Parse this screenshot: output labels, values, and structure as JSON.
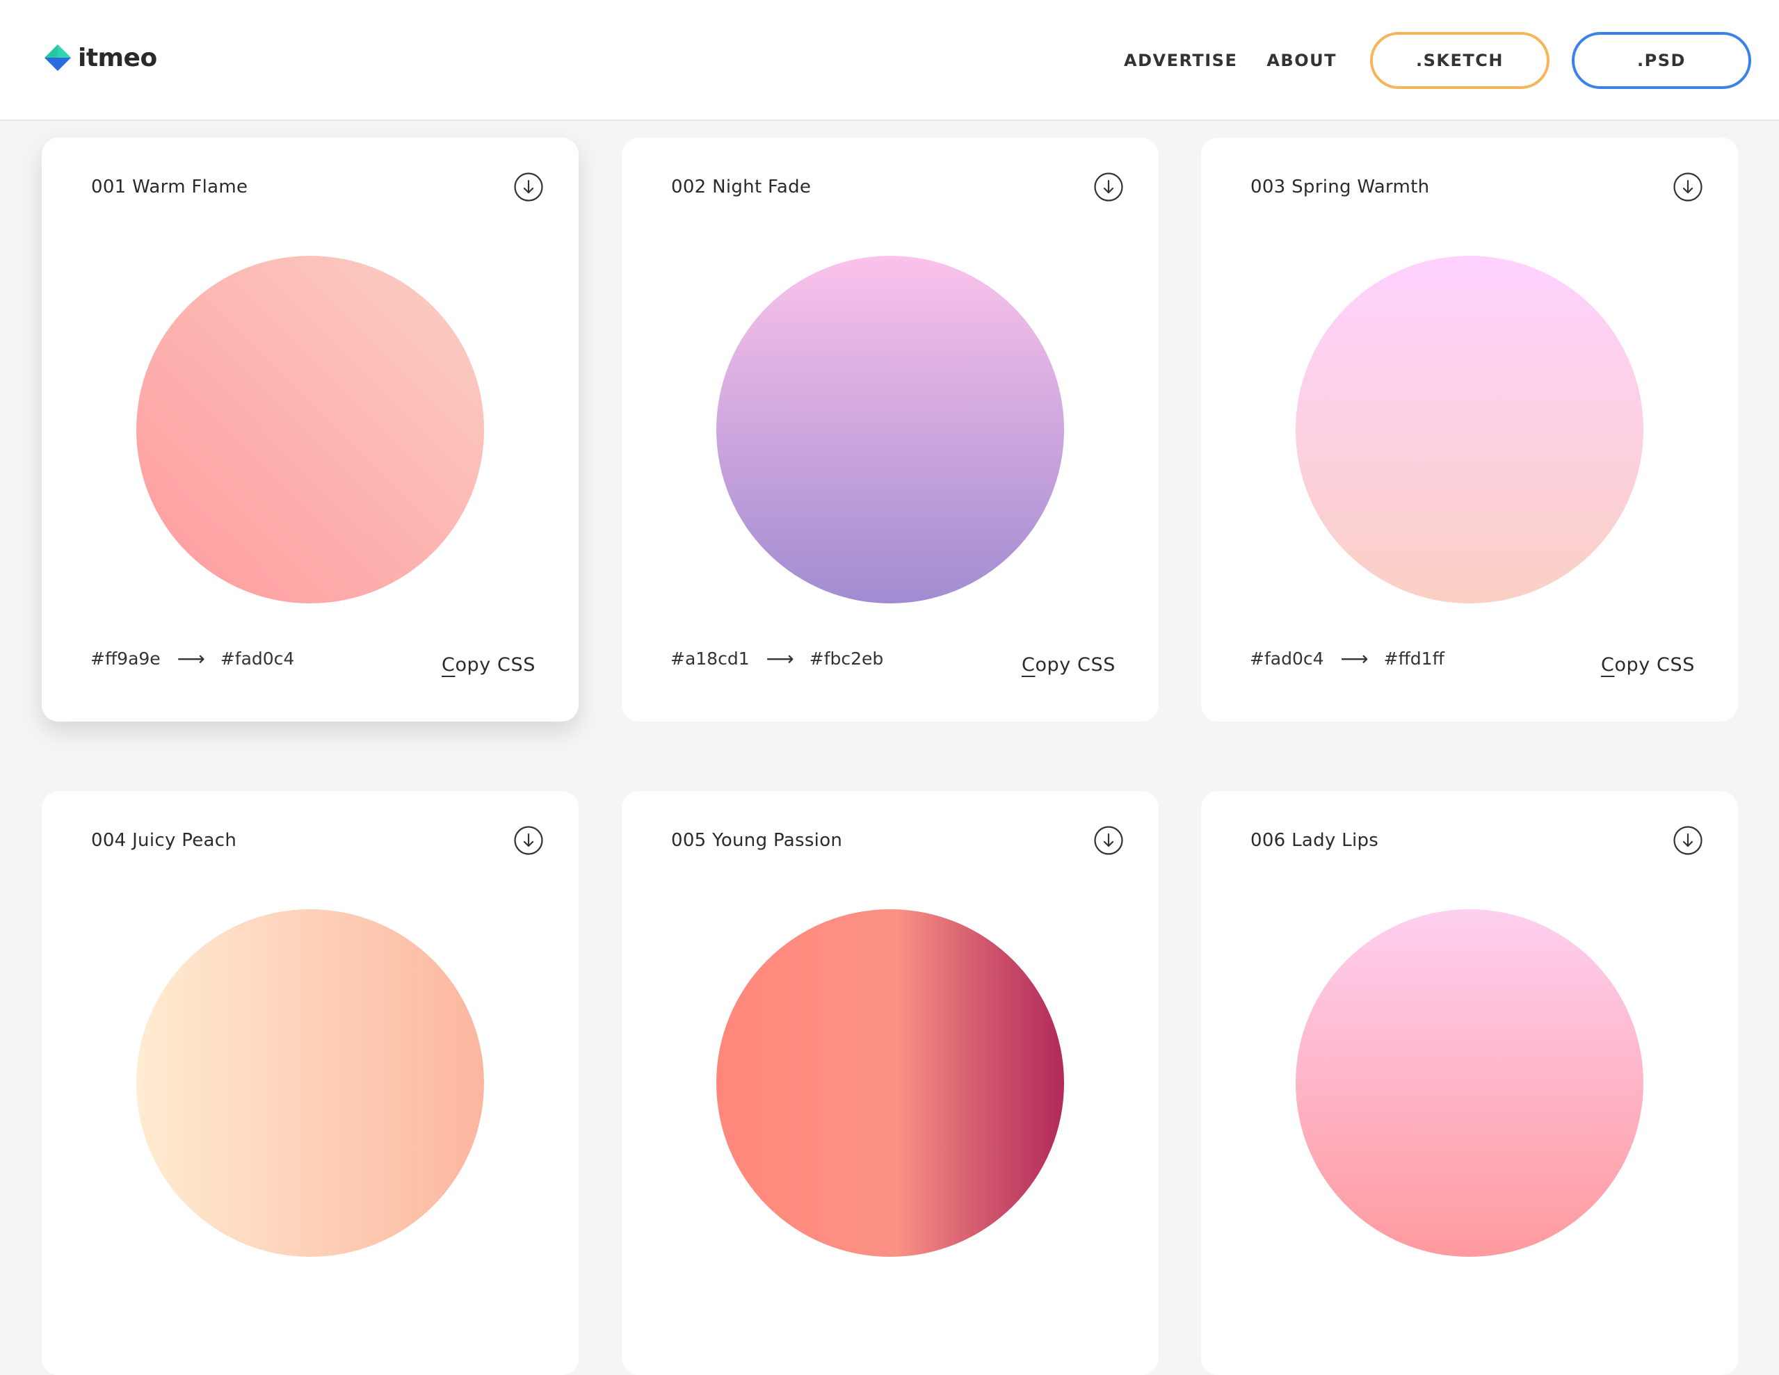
{
  "header": {
    "logo_text": "itmeo",
    "nav": {
      "advertise": "ADVERTISE",
      "about": "ABOUT",
      "sketch": ".SKETCH",
      "psd": ".PSD"
    },
    "colors": {
      "sketch_border": "#f6b55b",
      "psd_border": "#3b82e8"
    }
  },
  "cards": [
    {
      "title": "001 Warm Flame",
      "from": "#ff9a9e",
      "to": "#fad0c4",
      "arrow": "⟶",
      "copy_label_first": "C",
      "copy_label_rest": "opy CSS",
      "download_icon": "download-circle-icon"
    },
    {
      "title": "002 Night Fade",
      "from": "#a18cd1",
      "to": "#fbc2eb",
      "arrow": "⟶",
      "copy_label_first": "C",
      "copy_label_rest": "opy CSS",
      "download_icon": "download-circle-icon"
    },
    {
      "title": "003 Spring Warmth",
      "from": "#fad0c4",
      "to": "#ffd1ff",
      "arrow": "⟶",
      "copy_label_first": "C",
      "copy_label_rest": "opy CSS",
      "download_icon": "download-circle-icon"
    },
    {
      "title": "004 Juicy Peach",
      "download_icon": "download-circle-icon"
    },
    {
      "title": "005 Young Passion",
      "download_icon": "download-circle-icon"
    },
    {
      "title": "006 Lady Lips",
      "download_icon": "download-circle-icon"
    }
  ]
}
